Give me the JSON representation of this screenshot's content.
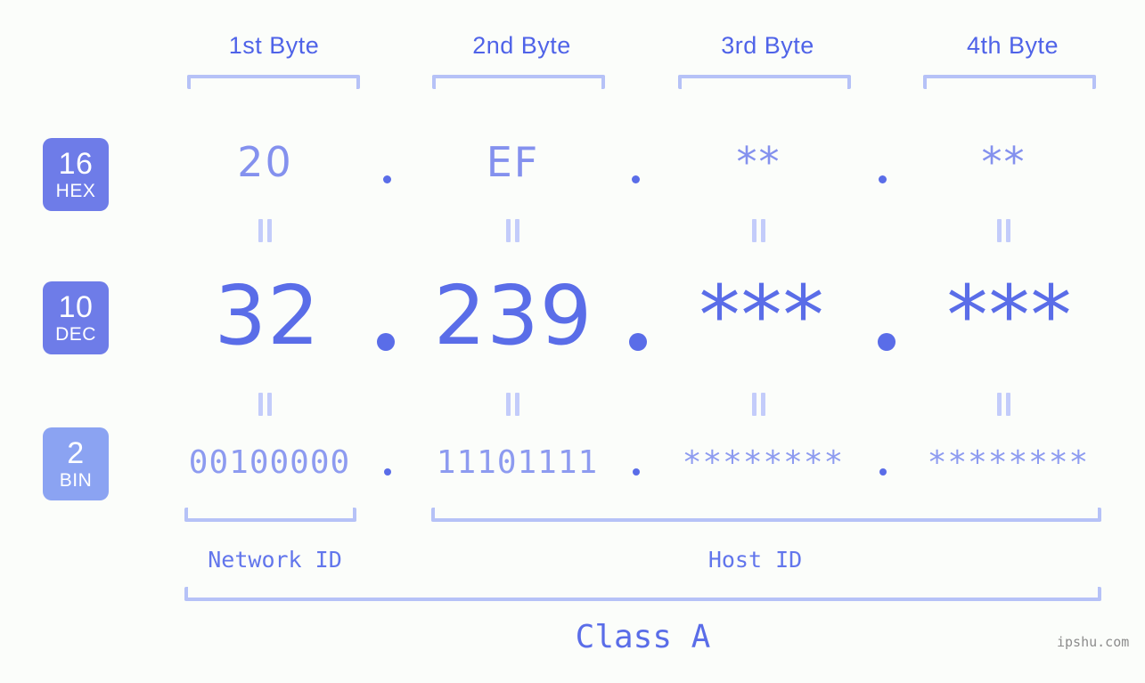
{
  "background_color": "#fbfdfa",
  "colors": {
    "header_text": "#4f63e8",
    "bracket": "#b6c2f7",
    "badge_strong": "#6e7ce8",
    "badge_light": "#8ba3f2",
    "hex_value": "#8491ee",
    "dec_value": "#5a6de8",
    "bin_value": "#8d9bf0",
    "equals_mark": "#c3ccfa",
    "id_label": "#6276ec",
    "watermark": "#8c8c8c"
  },
  "byte_headers": [
    {
      "label": "1st Byte"
    },
    {
      "label": "2nd Byte"
    },
    {
      "label": "3rd Byte"
    },
    {
      "label": "4th Byte"
    }
  ],
  "rows": [
    {
      "badge": {
        "number": "16",
        "name": "HEX"
      },
      "octets": [
        "20",
        "EF",
        "**",
        "**"
      ],
      "separator": "."
    },
    {
      "badge": {
        "number": "10",
        "name": "DEC"
      },
      "octets": [
        "32",
        "239",
        "***",
        "***"
      ],
      "separator": "."
    },
    {
      "badge": {
        "number": "2",
        "name": "BIN"
      },
      "octets": [
        "00100000",
        "11101111",
        "********",
        "********"
      ],
      "separator": "."
    }
  ],
  "equality_marks": {
    "symbol": "=",
    "count_per_row_gap": 4
  },
  "id_sections": [
    {
      "label": "Network ID"
    },
    {
      "label": "Host ID"
    }
  ],
  "class": {
    "label": "Class A"
  },
  "watermark": {
    "text": "ipshu.com"
  }
}
